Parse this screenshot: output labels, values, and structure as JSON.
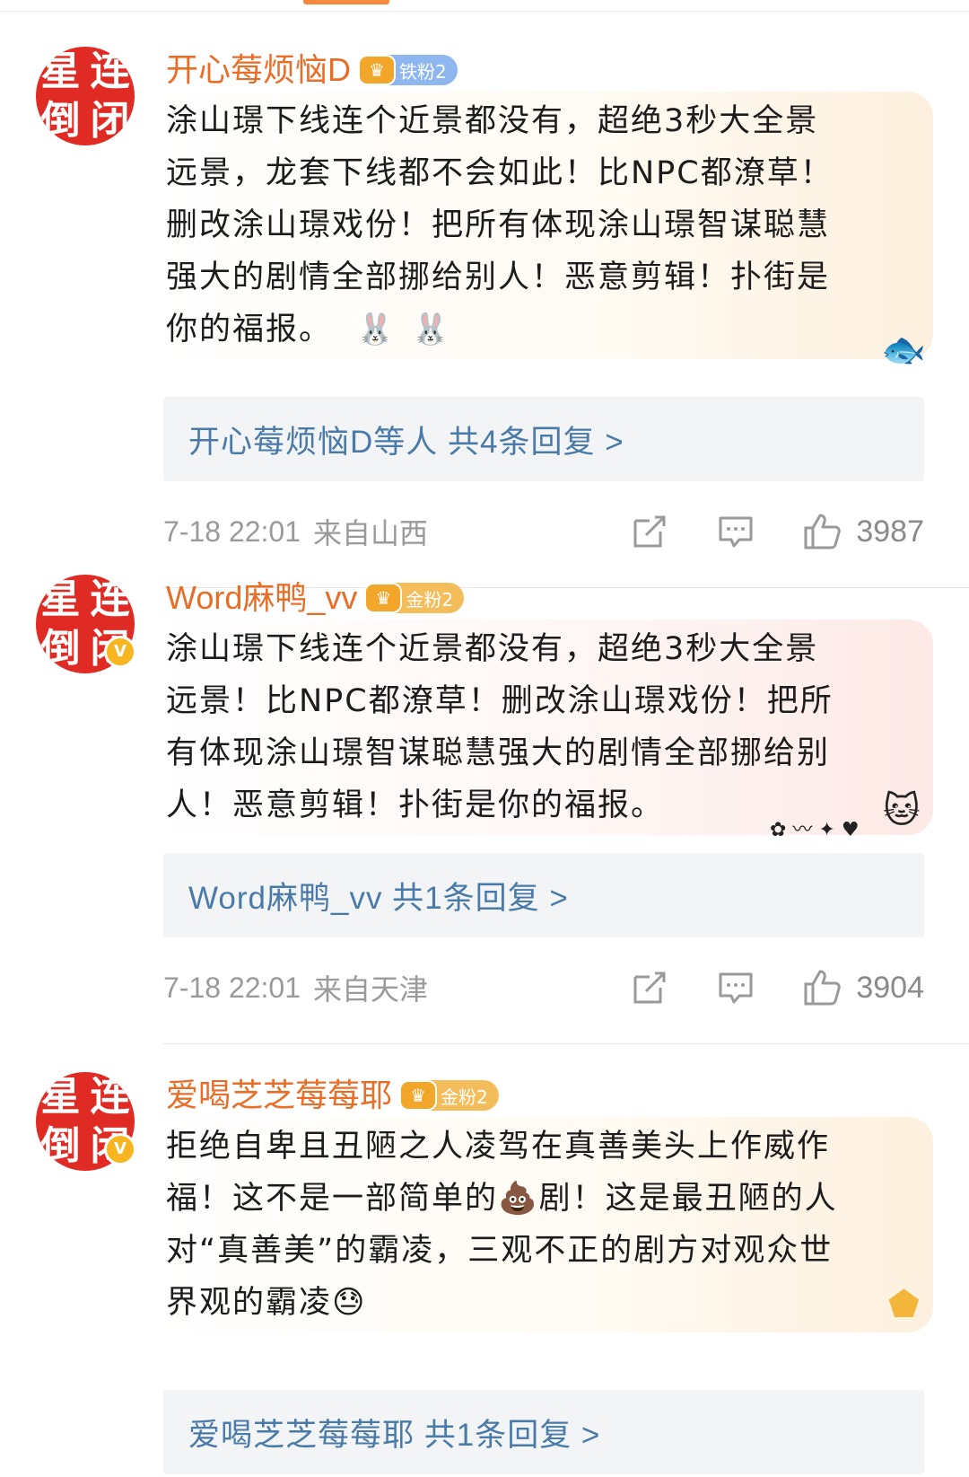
{
  "comments": [
    {
      "avatar_chars": [
        "星",
        "连",
        "倒",
        "闭"
      ],
      "verified": false,
      "username": "开心莓烦恼D",
      "fan_badge": "铁粉2",
      "fan_badge_level": "iron",
      "text_lines": [
        "涂山璟下线连个近景都没有，超绝3秒大全景",
        "远景，龙套下线都不会如此！比NPC都潦草！",
        "删改涂山璟戏份！把所有体现涂山璟智谋聪慧",
        "强大的剧情全部挪给别人！恶意剪辑！扑街是",
        "你的福报。"
      ],
      "reply_summary": "开心莓烦恼D等人  共4条回复 >",
      "time": "7-18 22:01",
      "location": "来自山西",
      "likes": "3987"
    },
    {
      "avatar_chars": [
        "星",
        "连",
        "倒",
        "闭"
      ],
      "verified": true,
      "username": "Word麻鸭_vv",
      "fan_badge": "金粉2",
      "fan_badge_level": "gold",
      "text_lines": [
        "涂山璟下线连个近景都没有，超绝3秒大全景",
        "远景！比NPC都潦草！删改涂山璟戏份！把所",
        "有体现涂山璟智谋聪慧强大的剧情全部挪给别",
        "人！恶意剪辑！扑街是你的福报。"
      ],
      "reply_summary": "Word麻鸭_vv  共1条回复 >",
      "time": "7-18 22:01",
      "location": "来自天津",
      "likes": "3904"
    },
    {
      "avatar_chars": [
        "星",
        "连",
        "倒",
        "闭"
      ],
      "verified": true,
      "username": "爱喝芝芝莓莓耶",
      "fan_badge": "金粉2",
      "fan_badge_level": "gold",
      "text_lines": [
        "拒绝自卑且丑陋之人凌驾在真善美头上作威作",
        "福！这不是一部简单的💩剧！这是最丑陋的人",
        "对“真善美”的霸凌，三观不正的剧方对观众世",
        "界观的霸凌😓"
      ],
      "reply_summary": "爱喝芝芝莓莓耶  共1条回复 >"
    }
  ],
  "icons": {
    "verify_badge": "verified-v-icon",
    "share": "share-icon",
    "comment": "comment-icon",
    "like": "like-thumb-icon",
    "crown": "fan-crown-icon",
    "sticker_rabbit": "rabbit-sticker-icon",
    "bubble_fish": "fish-decoration-icon",
    "bubble_cat": "cat-decoration-icon",
    "bubble_star": "star-badge-decoration-icon"
  },
  "colors": {
    "username": "#e86e27",
    "reply_link": "#4a7aa8",
    "meta_gray": "#9a9a9a",
    "avatar_red": "#e02a24",
    "verified_yellow": "#f7b61f",
    "iron_badge": "#8db7ee",
    "gold_badge": "#f4bd5c",
    "accent_tab": "#f58a3c"
  }
}
